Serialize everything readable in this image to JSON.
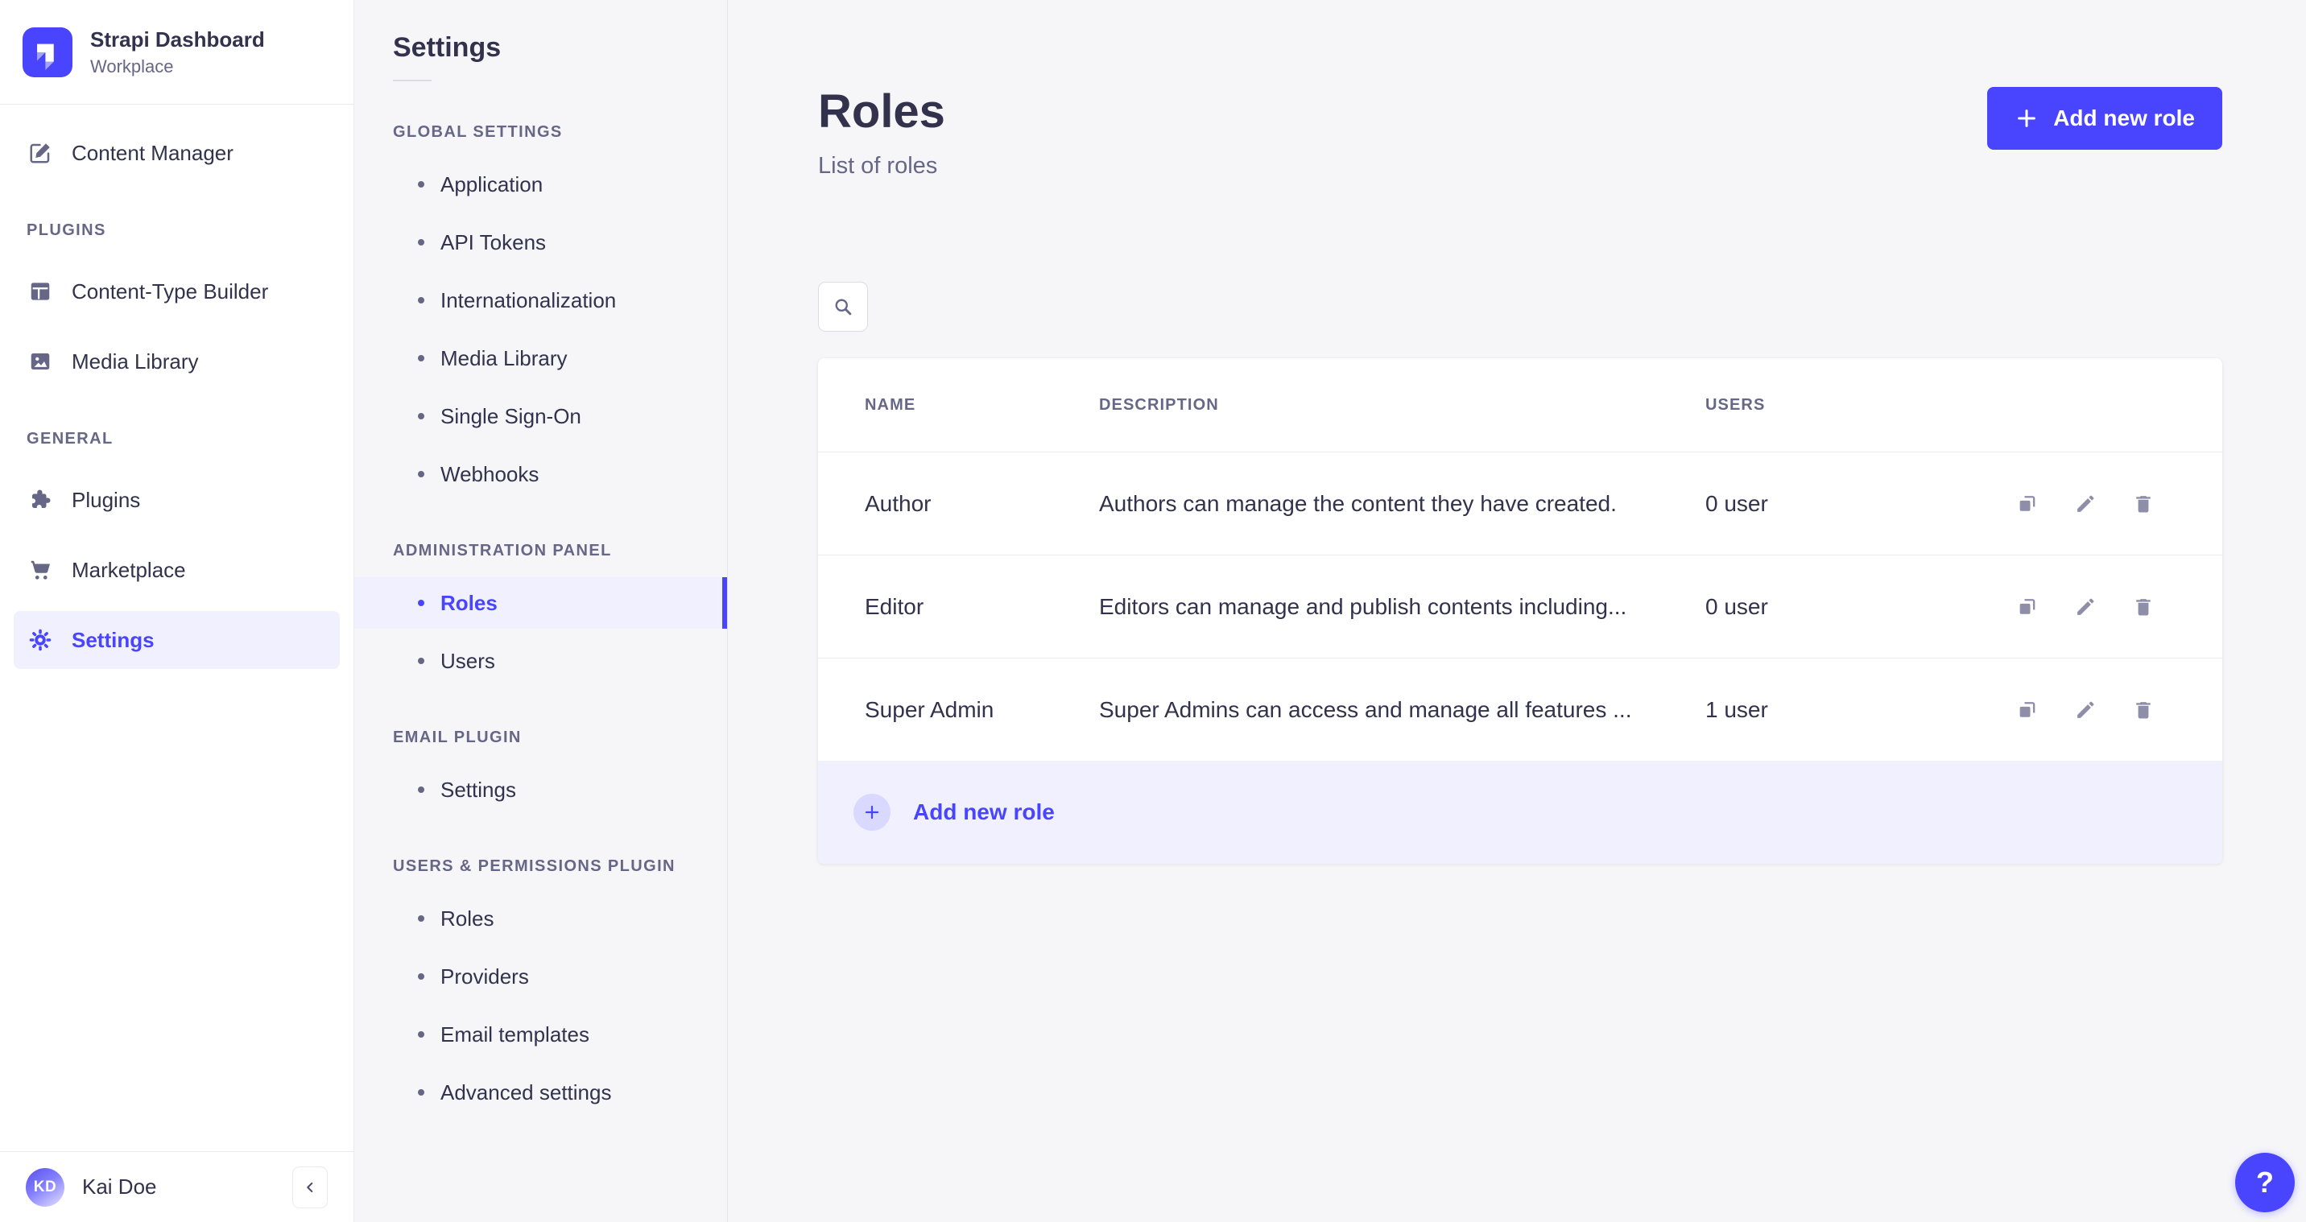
{
  "brand": {
    "title": "Strapi Dashboard",
    "subtitle": "Workplace",
    "logo_icon": "strapi-logo"
  },
  "main_nav": {
    "section_headers": [
      "PLUGINS",
      "GENERAL"
    ],
    "items": [
      {
        "label": "Content Manager",
        "icon": "content-manager-icon",
        "active": false
      },
      {
        "label": "Content-Type Builder",
        "icon": "content-type-builder-icon",
        "active": false
      },
      {
        "label": "Media Library",
        "icon": "media-library-icon",
        "active": false
      },
      {
        "label": "Plugins",
        "icon": "puzzle-icon",
        "active": false
      },
      {
        "label": "Marketplace",
        "icon": "cart-icon",
        "active": false
      },
      {
        "label": "Settings",
        "icon": "gear-icon",
        "active": true
      }
    ]
  },
  "user": {
    "initials": "KD",
    "name": "Kai Doe",
    "collapse_icon": "chevron-left-icon"
  },
  "subnav": {
    "title": "Settings",
    "active_item": "Roles",
    "sections": [
      {
        "header": "GLOBAL SETTINGS",
        "items": [
          "Application",
          "API Tokens",
          "Internationalization",
          "Media Library",
          "Single Sign-On",
          "Webhooks"
        ]
      },
      {
        "header": "ADMINISTRATION PANEL",
        "items": [
          "Roles",
          "Users"
        ]
      },
      {
        "header": "EMAIL PLUGIN",
        "items": [
          "Settings"
        ]
      },
      {
        "header": "USERS & PERMISSIONS PLUGIN",
        "items": [
          "Roles",
          "Providers",
          "Email templates",
          "Advanced settings"
        ]
      }
    ]
  },
  "page": {
    "title": "Roles",
    "subtitle": "List of roles",
    "add_button_label": "Add new role",
    "search_icon": "search-icon"
  },
  "table": {
    "columns": [
      "NAME",
      "DESCRIPTION",
      "USERS"
    ],
    "rows": [
      {
        "name": "Author",
        "description": "Authors can manage the content they have created.",
        "users": "0 user"
      },
      {
        "name": "Editor",
        "description": "Editors can manage and publish contents including...",
        "users": "0 user"
      },
      {
        "name": "Super Admin",
        "description": "Super Admins can access and manage all features ...",
        "users": "1 user"
      }
    ],
    "row_action_icons": [
      "duplicate-icon",
      "pencil-icon",
      "trash-icon"
    ],
    "footer_add_label": "Add new role"
  },
  "help": {
    "label": "?"
  },
  "colors": {
    "primary": "#4945ff",
    "primary_light": "#f0f0ff",
    "primary_soft": "#d9d8ff",
    "text_dark": "#32324d",
    "text_gray": "#666687",
    "icon_gray": "#8e8ea9",
    "border": "#eaeaef",
    "background": "#f6f6f9",
    "surface": "#ffffff"
  }
}
